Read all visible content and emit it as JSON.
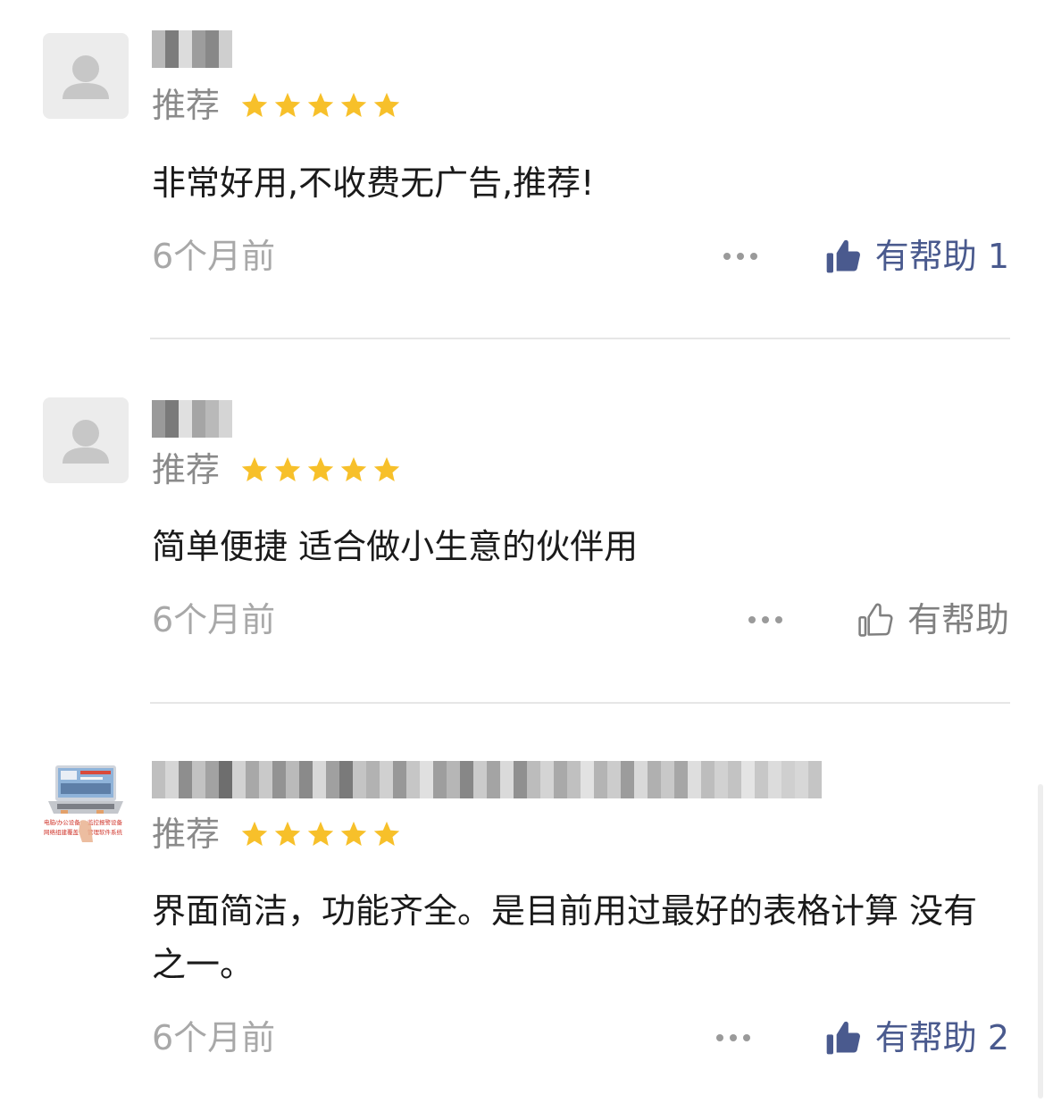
{
  "accent_color": "#4a5a8e",
  "star_color": "#f7c02a",
  "reviews": [
    {
      "avatar": "default-user-avatar",
      "recommend_label": "推荐",
      "rating": 5,
      "content": "非常好用,不收费无广告,推荐!",
      "time": "6个月前",
      "helpful_label": "有帮助",
      "helpful_count": "1",
      "helpful_active": true
    },
    {
      "avatar": "default-user-avatar",
      "recommend_label": "推荐",
      "rating": 5,
      "content": "简单便捷 适合做小生意的伙伴用",
      "time": "6个月前",
      "helpful_label": "有帮助",
      "helpful_count": "",
      "helpful_active": false
    },
    {
      "avatar": "laptop-store-avatar",
      "avatar_text": {
        "line1_left": "电脑/办公设备",
        "line1_right": "监控报警设备",
        "line2_left": "网络组建覆盖",
        "line2_right": "管理软件系统"
      },
      "recommend_label": "推荐",
      "rating": 5,
      "content": "界面简洁，功能齐全。是目前用过最好的表格计算 没有之一。",
      "time": "6个月前",
      "helpful_label": "有帮助",
      "helpful_count": "2",
      "helpful_active": true
    }
  ]
}
